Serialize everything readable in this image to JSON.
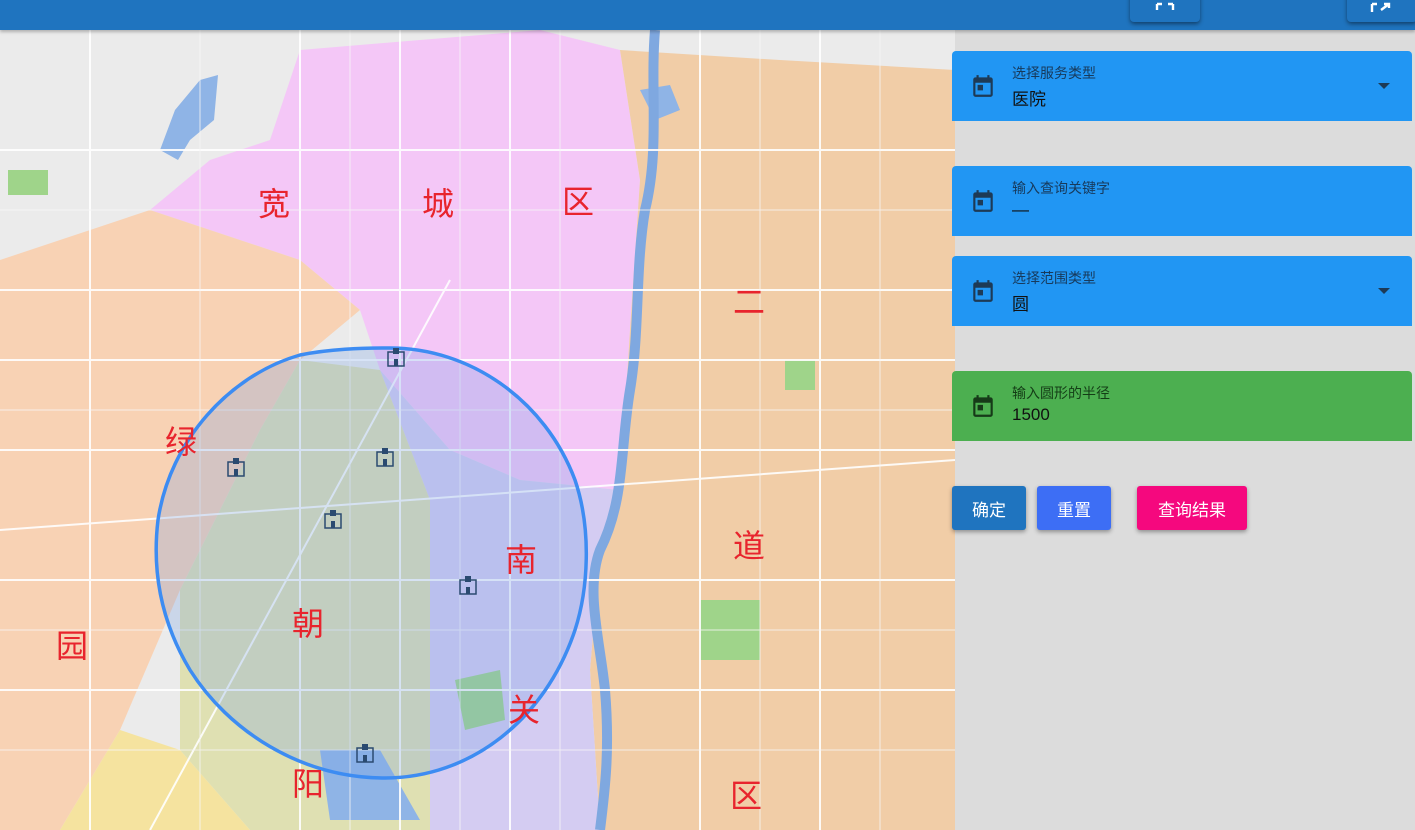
{
  "toolbar": {
    "buttons": [
      {
        "icon": "fullscreen-icon"
      },
      {
        "icon": "export-icon"
      }
    ]
  },
  "map": {
    "districts": [
      "宽",
      "城",
      "区",
      "二",
      "道",
      "区",
      "绿",
      "园",
      "朝",
      "阳",
      "南",
      "关"
    ],
    "markers_icon": "hospital-icon",
    "circle_color": "#3d8cf2"
  },
  "form": {
    "service_type": {
      "label": "选择服务类型",
      "value": "医院"
    },
    "keyword": {
      "label": "输入查询关键字",
      "value": "—"
    },
    "range_type": {
      "label": "选择范围类型",
      "value": "圆"
    },
    "radius": {
      "label": "输入圆形的半径",
      "value": "1500"
    }
  },
  "buttons": {
    "confirm": "确定",
    "reset": "重置",
    "results": "查询结果"
  },
  "colors": {
    "topbar": "#1f74bf",
    "field_blue": "#2196f3",
    "field_green": "#4caf50",
    "confirm": "#1f74bf",
    "reset": "#3d6ef5",
    "results": "#f5087e"
  }
}
